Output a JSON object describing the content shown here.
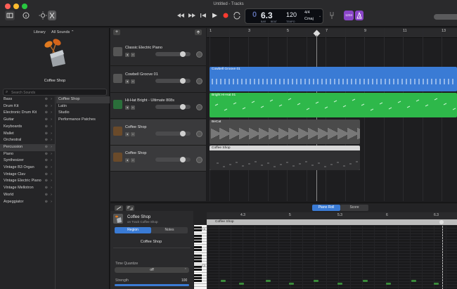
{
  "window": {
    "title": "Untitled - Tracks"
  },
  "transport": {
    "position": "6.3",
    "bar_label": "BAR",
    "beat_label": "BEAT",
    "tempo": "120",
    "tempo_label": "TEMPO",
    "time_signature": "4/4",
    "key": "Cmaj",
    "count_in": "1234"
  },
  "library": {
    "header": "Library",
    "filter": "All Sounds",
    "patch_name": "Coffee Shop",
    "search_placeholder": "Search Sounds",
    "categories": [
      {
        "label": "Bass"
      },
      {
        "label": "Drum Kit"
      },
      {
        "label": "Electronic Drum Kit"
      },
      {
        "label": "Guitar"
      },
      {
        "label": "Keyboards"
      },
      {
        "label": "Mallet"
      },
      {
        "label": "Orchestral"
      },
      {
        "label": "Percussion"
      },
      {
        "label": "Piano"
      },
      {
        "label": "Synthesizer"
      },
      {
        "label": "Vintage B3 Organ"
      },
      {
        "label": "Vintage Clav"
      },
      {
        "label": "Vintage Electric Piano"
      },
      {
        "label": "Vintage Mellotron"
      },
      {
        "label": "World"
      },
      {
        "label": "Arpeggiator"
      }
    ],
    "subcategories": [
      {
        "label": "Coffee Shop"
      },
      {
        "label": "Latin"
      },
      {
        "label": "Studio"
      },
      {
        "label": "Performance Patches"
      }
    ]
  },
  "tracks": [
    {
      "name": "Classic Electric Piano",
      "color": "#7a7a7a"
    },
    {
      "name": "Cowbell Groove 01",
      "color": "#3a7bd5"
    },
    {
      "name": "Hi-Hat Bright - Ultimate 808s",
      "color": "#2eb84a"
    },
    {
      "name": "Coffee Shop",
      "color": "#9a9a9a"
    },
    {
      "name": "Coffee Shop",
      "color": "#cfcfcf"
    }
  ],
  "ruler": {
    "bars": [
      "1",
      "3",
      "5",
      "7",
      "9",
      "11",
      "13"
    ]
  },
  "regions": [
    {
      "label": "Cowbell Groove 01",
      "color": "#3a7bd5"
    },
    {
      "label": "Bright Hi-Hat 01",
      "color": "#2eb84a"
    },
    {
      "label": "BeCat",
      "color": "#4a4a4a"
    },
    {
      "label": "Coffee Shop",
      "color": "#d8d8d8"
    }
  ],
  "editor": {
    "track_name": "Coffee Shop",
    "track_sub": "on Track Coffee Shop",
    "tab_region": "Region",
    "tab_notes": "Notes",
    "region_name": "Coffee Shop",
    "mode_piano_roll": "Piano Roll",
    "mode_score": "Score",
    "time_quantize_label": "Time Quantize",
    "time_quantize_value": "off",
    "strength_label": "Strength",
    "strength_value": "100",
    "ruler": [
      "4.3",
      "5",
      "5.3",
      "6",
      "6.3"
    ],
    "region_label": "Coffee Shop",
    "key_c4": "C4",
    "key_c3": "C3"
  }
}
